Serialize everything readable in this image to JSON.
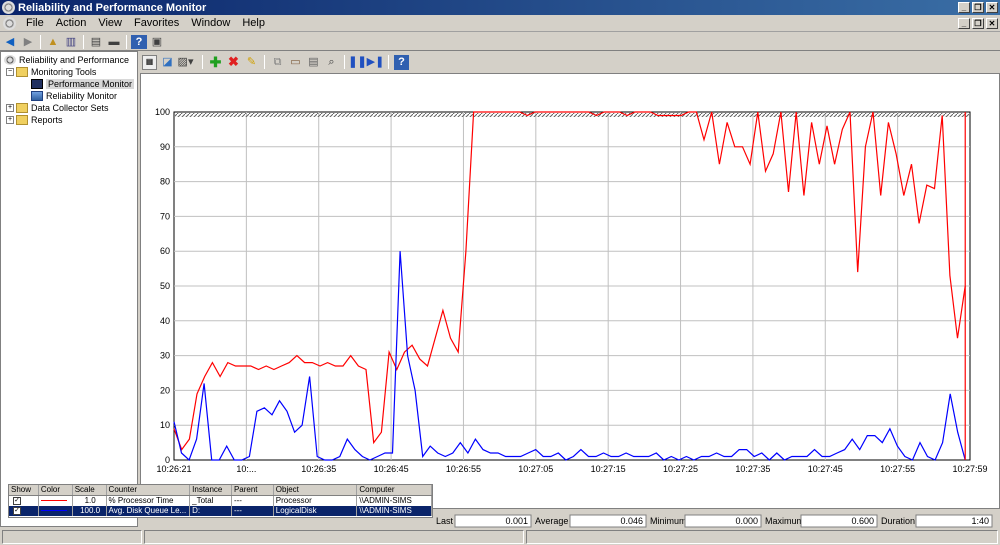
{
  "window": {
    "title": "Reliability and Performance Monitor"
  },
  "menu": [
    "File",
    "Action",
    "View",
    "Favorites",
    "Window",
    "Help"
  ],
  "tree": [
    {
      "label": "Reliability and Performance",
      "level": 0,
      "icon": "gauge-icon",
      "expander": ""
    },
    {
      "label": "Monitoring Tools",
      "level": 1,
      "icon": "folder-icon",
      "expander": "−"
    },
    {
      "label": "Performance Monitor",
      "level": 2,
      "icon": "monitor-icon",
      "expander": "",
      "selected": true
    },
    {
      "label": "Reliability Monitor",
      "level": 2,
      "icon": "reliability-icon",
      "expander": ""
    },
    {
      "label": "Data Collector Sets",
      "level": 1,
      "icon": "folder-icon",
      "expander": "+"
    },
    {
      "label": "Reports",
      "level": 1,
      "icon": "folder-icon",
      "expander": "+"
    }
  ],
  "stats": {
    "last_label": "Last",
    "last": "0.001",
    "average_label": "Average",
    "average": "0.046",
    "minimum_label": "Minimum",
    "minimum": "0.000",
    "maximum_label": "Maximum",
    "maximum": "0.600",
    "duration_label": "Duration",
    "duration": "1:40"
  },
  "counter_columns": [
    "Show",
    "Color",
    "Scale",
    "Counter",
    "Instance",
    "Parent",
    "Object",
    "Computer"
  ],
  "counters": [
    {
      "show": "✓",
      "color": "#ff0000",
      "scale": "1.0",
      "counter": "% Processor Time",
      "instance": "_Total",
      "parent": "---",
      "object": "Processor",
      "computer": "\\\\ADMIN-SIMS",
      "selected": false
    },
    {
      "show": "✓",
      "color": "#0000ff",
      "scale": "100.0",
      "counter": "Avg. Disk Queue Le...",
      "instance": "D:",
      "parent": "---",
      "object": "LogicalDisk",
      "computer": "\\\\ADMIN-SIMS",
      "selected": true
    }
  ],
  "chart_data": {
    "type": "line",
    "ylim": [
      0,
      100
    ],
    "yticks": [
      "0",
      "10",
      "20",
      "30",
      "40",
      "50",
      "60",
      "70",
      "80",
      "90",
      "100"
    ],
    "xticks": [
      "10:26:21",
      "10:...",
      "10:26:35",
      "10:26:45",
      "10:26:55",
      "10:27:05",
      "10:27:15",
      "10:27:25",
      "10:27:35",
      "10:27:45",
      "10:27:55",
      "10:27:59"
    ],
    "grid": true,
    "series": [
      {
        "color": "#ff0000",
        "values": [
          9,
          3,
          6,
          19,
          24,
          28,
          24,
          28,
          27,
          27,
          27,
          26,
          27,
          26,
          27,
          28,
          30,
          28,
          28,
          27,
          28,
          27,
          27,
          30,
          27,
          26,
          5,
          8,
          31,
          26,
          31,
          33,
          29,
          27,
          35,
          43,
          35,
          31,
          60,
          100,
          100,
          100,
          100,
          100,
          100,
          100,
          99,
          100,
          100,
          100,
          100,
          100,
          100,
          100,
          100,
          99,
          100,
          100,
          100,
          99,
          100,
          100,
          100,
          99,
          99,
          99,
          99,
          100,
          100,
          92,
          100,
          85,
          97,
          90,
          90,
          85,
          100,
          83,
          88,
          100,
          77,
          100,
          76,
          97,
          85,
          96,
          85,
          95,
          100,
          54,
          90,
          100,
          76,
          97,
          88,
          76,
          85,
          68,
          79,
          78,
          99,
          53,
          35,
          50
        ]
      },
      {
        "color": "#0000ff",
        "values": [
          11,
          2,
          0,
          6,
          22,
          0,
          0,
          4,
          0,
          0,
          1,
          14,
          15,
          13,
          17,
          14,
          8,
          10,
          24,
          1,
          0,
          0,
          1,
          6,
          3,
          1,
          0,
          1,
          2,
          2,
          60,
          30,
          20,
          1,
          4,
          2,
          1,
          2,
          5,
          2,
          6,
          3,
          2,
          2,
          1,
          1,
          1,
          2,
          3,
          1,
          1,
          2,
          0,
          1,
          3,
          1,
          1,
          2,
          1,
          1,
          2,
          1,
          1,
          1,
          2,
          0,
          1,
          0,
          1,
          0,
          1,
          1,
          2,
          1,
          1,
          3,
          3,
          1,
          2,
          0,
          2,
          0,
          1,
          1,
          1,
          3,
          1,
          1,
          2,
          3,
          6,
          3,
          7,
          7,
          5,
          9,
          4,
          1,
          0,
          5,
          1,
          0,
          5,
          19,
          8,
          0
        ]
      }
    ]
  }
}
